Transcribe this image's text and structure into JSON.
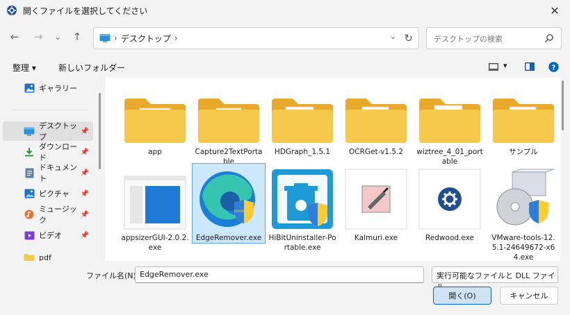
{
  "window": {
    "title": "開くファイルを選択してください",
    "close_glyph": "✕"
  },
  "nav": {
    "back": "←",
    "forward": "→",
    "recent": "⌄",
    "up": "↑",
    "crumb_sep": "›",
    "refresh": "↻",
    "dropdown": "⌄"
  },
  "address": {
    "location": "デスクトップ"
  },
  "search": {
    "placeholder": "デスクトップの検索"
  },
  "toolbar": {
    "organize": "整理",
    "organize_caret": "▾",
    "new_folder": "新しいフォルダー",
    "view_caret": "▾"
  },
  "sidebar": {
    "items": [
      {
        "label": "ギャラリー",
        "icon": "gallery-icon",
        "pinned": false
      },
      {
        "label": "デスクトップ",
        "icon": "desktop-icon",
        "pinned": true,
        "selected": true
      },
      {
        "label": "ダウンロード",
        "icon": "download-icon",
        "pinned": true
      },
      {
        "label": "ドキュメント",
        "icon": "document-icon",
        "pinned": true
      },
      {
        "label": "ピクチャ",
        "icon": "pictures-icon",
        "pinned": true
      },
      {
        "label": "ミュージック",
        "icon": "music-icon",
        "pinned": true
      },
      {
        "label": "ビデオ",
        "icon": "video-icon",
        "pinned": true
      },
      {
        "label": "pdf",
        "icon": "folder-icon",
        "pinned": false
      }
    ],
    "pin_glyph": "📌"
  },
  "files": [
    {
      "name": "app",
      "kind": "folder"
    },
    {
      "name": "Capture2TextPortable",
      "kind": "folder"
    },
    {
      "name": "HDGraph_1.5.1",
      "kind": "folder"
    },
    {
      "name": "OCRGet-v1.5.2",
      "kind": "folder"
    },
    {
      "name": "wiztree_4_01_portable",
      "kind": "folder"
    },
    {
      "name": "サンプル",
      "kind": "folder"
    },
    {
      "name": "appsizerGUI-2.0.2.exe",
      "kind": "exe"
    },
    {
      "name": "EdgeRemover.exe",
      "kind": "exe",
      "selected": true
    },
    {
      "name": "HiBitUninstaller-Portable.exe",
      "kind": "exe"
    },
    {
      "name": "Kalmuri.exe",
      "kind": "exe"
    },
    {
      "name": "Redwood.exe",
      "kind": "exe"
    },
    {
      "name": "VMware-tools-12.5.1-24649672-x64.exe",
      "kind": "exe"
    }
  ],
  "bottom": {
    "filename_label": "ファイル名(N):",
    "filename_value": "EdgeRemover.exe",
    "filter_value": "実行可能なファイルと DLL ファイル",
    "dropdown": "⌄",
    "open_label": "開く(O)",
    "cancel_label": "キャンセル"
  },
  "colors": {
    "accent": "#0067c0",
    "folder": "#f7c94b",
    "selection": "#cce8ff"
  }
}
